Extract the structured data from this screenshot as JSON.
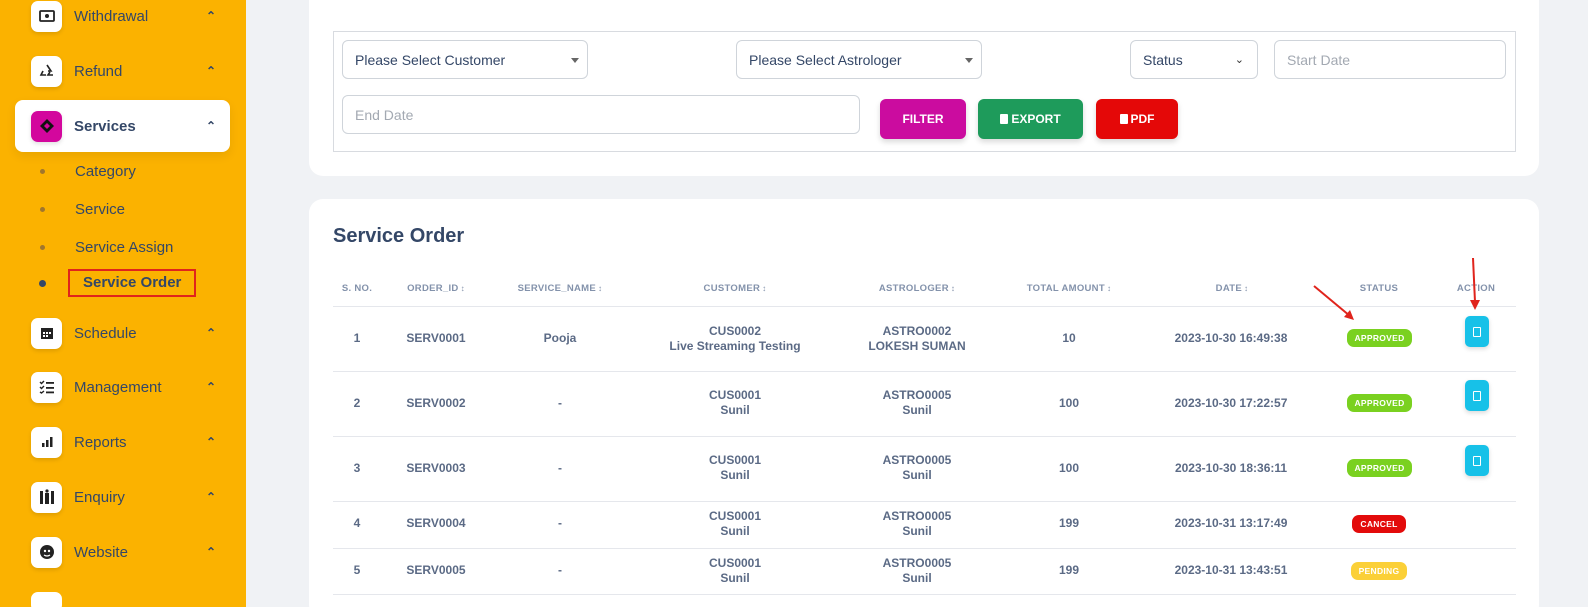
{
  "sidebar": {
    "items": [
      {
        "label": "Withdrawal",
        "icon": "money-icon"
      },
      {
        "label": "Refund",
        "icon": "recycle-icon"
      },
      {
        "label": "Services",
        "icon": "services-icon"
      },
      {
        "label": "Schedule",
        "icon": "calendar-icon"
      },
      {
        "label": "Management",
        "icon": "list-icon"
      },
      {
        "label": "Reports",
        "icon": "bar-chart-icon"
      },
      {
        "label": "Enquiry",
        "icon": "enquiry-icon"
      },
      {
        "label": "Website",
        "icon": "globe-icon"
      }
    ],
    "sub_items": [
      "Category",
      "Service",
      "Service Assign",
      "Service Order"
    ],
    "active_item": "Services",
    "active_sub_item": "Service Order",
    "accent_color": "#fbb200"
  },
  "filters": {
    "customer": "Please Select Customer",
    "astrologer": "Please Select Astrologer",
    "status": "Status",
    "start_date_placeholder": "Start Date",
    "end_date_placeholder": "End Date",
    "filter_label": "FILTER",
    "export_label": "EXPORT",
    "pdf_label": "PDF",
    "filter_color": "#cb0c9f",
    "export_color": "#1e9b5b",
    "pdf_color": "#e40808"
  },
  "table": {
    "title": "Service Order",
    "headers": [
      "S. NO.",
      "ORDER_ID",
      "SERVICE_NAME",
      "CUSTOMER",
      "ASTROLOGER",
      "TOTAL AMOUNT",
      "DATE",
      "STATUS",
      "ACTION"
    ],
    "rows": [
      {
        "sno": "1",
        "order_id": "SERV0001",
        "service": "Pooja",
        "cust_id": "CUS0002",
        "cust_name": "Live Streaming Testing",
        "astro_id": "ASTRO0002",
        "astro_name": "LOKESH SUMAN",
        "amount": "10",
        "date": "2023-10-30 16:49:38",
        "status": "APPROVED"
      },
      {
        "sno": "2",
        "order_id": "SERV0002",
        "service": "-",
        "cust_id": "CUS0001",
        "cust_name": "Sunil",
        "astro_id": "ASTRO0005",
        "astro_name": "Sunil",
        "amount": "100",
        "date": "2023-10-30 17:22:57",
        "status": "APPROVED"
      },
      {
        "sno": "3",
        "order_id": "SERV0003",
        "service": "-",
        "cust_id": "CUS0001",
        "cust_name": "Sunil",
        "astro_id": "ASTRO0005",
        "astro_name": "Sunil",
        "amount": "100",
        "date": "2023-10-30 18:36:11",
        "status": "APPROVED"
      },
      {
        "sno": "4",
        "order_id": "SERV0004",
        "service": "-",
        "cust_id": "CUS0001",
        "cust_name": "Sunil",
        "astro_id": "ASTRO0005",
        "astro_name": "Sunil",
        "amount": "199",
        "date": "2023-10-31 13:17:49",
        "status": "CANCEL"
      },
      {
        "sno": "5",
        "order_id": "SERV0005",
        "service": "-",
        "cust_id": "CUS0001",
        "cust_name": "Sunil",
        "astro_id": "ASTRO0005",
        "astro_name": "Sunil",
        "amount": "199",
        "date": "2023-10-31 13:43:51",
        "status": "PENDING"
      }
    ]
  }
}
